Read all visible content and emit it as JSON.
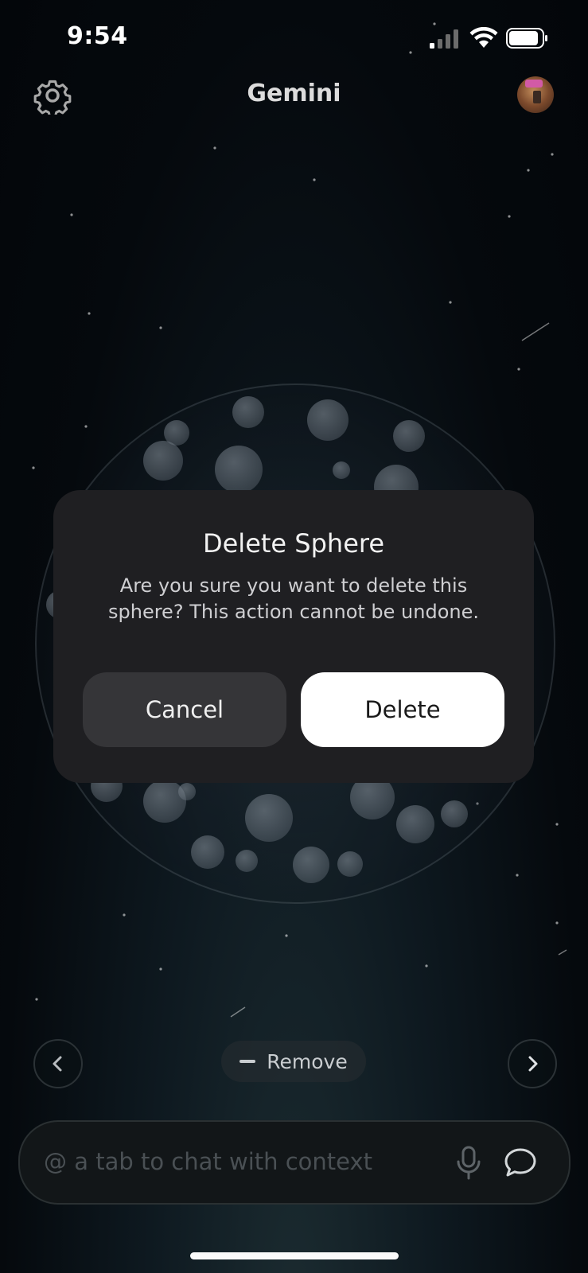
{
  "status_bar": {
    "time": "9:54"
  },
  "header": {
    "title": "Gemini",
    "settings_icon": "gear-icon",
    "avatar_icon": "profile-avatar"
  },
  "dialog": {
    "title": "Delete Sphere",
    "message": "Are you sure you want to delete this sphere? This action cannot be undone.",
    "cancel_label": "Cancel",
    "delete_label": "Delete"
  },
  "controls": {
    "prev_icon": "chevron-left-icon",
    "next_icon": "chevron-right-icon",
    "remove_label": "Remove"
  },
  "chat": {
    "placeholder": "@ a tab to chat with context",
    "mic_icon": "mic-icon",
    "chat_icon": "chat-bubble-icon"
  },
  "colors": {
    "background": "#05090d",
    "dialog": "#1f1f22",
    "delete_button": "#ffffff",
    "cancel_button": "#353538"
  }
}
